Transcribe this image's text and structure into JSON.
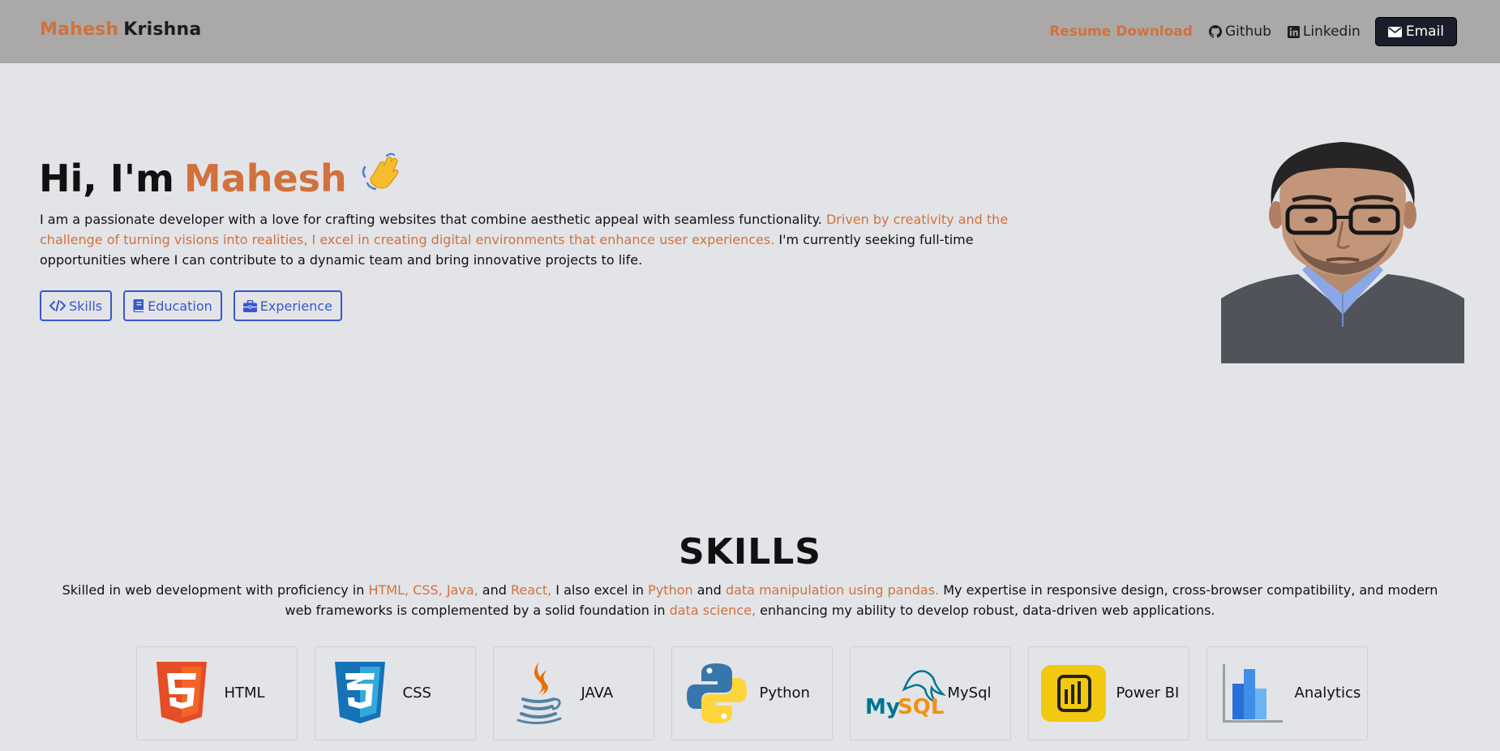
{
  "brand": {
    "first": "Mahesh",
    "last": "Krishna"
  },
  "nav": {
    "resume": "Resume Download",
    "github": "Github",
    "linkedin": "Linkedin",
    "email": "Email"
  },
  "hero": {
    "greeting": "Hi, I'm",
    "name": "Mahesh",
    "intro_part1": "I am a passionate developer with a love for crafting websites that combine aesthetic appeal with seamless functionality.",
    "intro_highlight": "Driven by creativity and the challenge of turning visions into realities, I excel in creating digital environments that enhance user experiences.",
    "intro_part2": "I'm currently seeking full-time opportunities where I can contribute to a dynamic team and bring innovative projects to life.",
    "buttons": {
      "skills": "Skills",
      "education": "Education",
      "experience": "Experience"
    }
  },
  "skills": {
    "title": "SKILLS",
    "desc": {
      "t1": "Skilled in web development with proficiency in",
      "h1": "HTML, CSS, Java,",
      "t2": "and",
      "h2": "React,",
      "t3": "I also excel in",
      "h3": "Python",
      "t4": "and",
      "h4": "data manipulation using pandas.",
      "t5": "My expertise in responsive design, cross-browser compatibility, and modern web frameworks is complemented by a solid foundation in",
      "h5": "data science,",
      "t6": "enhancing my ability to develop robust, data-driven web applications."
    },
    "cards": [
      {
        "label": "HTML",
        "icon": "html5-icon"
      },
      {
        "label": "CSS",
        "icon": "css3-icon"
      },
      {
        "label": "JAVA",
        "icon": "java-icon"
      },
      {
        "label": "Python",
        "icon": "python-icon"
      },
      {
        "label": "MySql",
        "icon": "mysql-icon"
      },
      {
        "label": "Power BI",
        "icon": "powerbi-icon"
      },
      {
        "label": "Analytics",
        "icon": "analytics-icon"
      }
    ]
  },
  "colors": {
    "accent": "#d1713c",
    "link_blue": "#3758cc",
    "navbar": "#aaa9a8",
    "background": "#e3e4e8",
    "email_button": "#1c1d2a"
  }
}
